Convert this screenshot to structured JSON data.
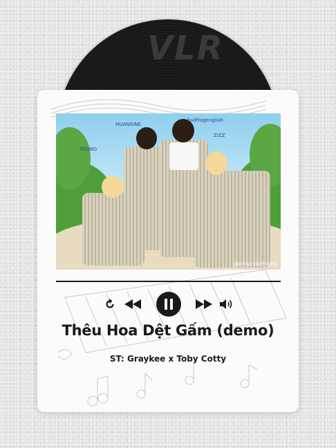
{
  "colors": {
    "background": "#e4e4e4",
    "card": "#fbfbfb",
    "vinyl": "#1a1a1a",
    "text": "#1a1a1a",
    "pause_button": "#1a1a1a"
  },
  "vinyl": {
    "logo": "VLR"
  },
  "album_art": {
    "tags": [
      "HUANXINE",
      "bullfrogenglish",
      "YOUNG",
      "ZIZZ"
    ],
    "watermark": "@nhacvanhoira"
  },
  "player": {
    "icons": {
      "repeat": "repeat-icon",
      "rewind": "rewind-icon",
      "play_pause": "pause-icon",
      "fast_forward": "fast-forward-icon",
      "volume": "volume-icon"
    },
    "song_title": "Thêu Hoa Dệt Gấm (demo)",
    "artists": "ST: Graykee x Toby Cotty"
  }
}
